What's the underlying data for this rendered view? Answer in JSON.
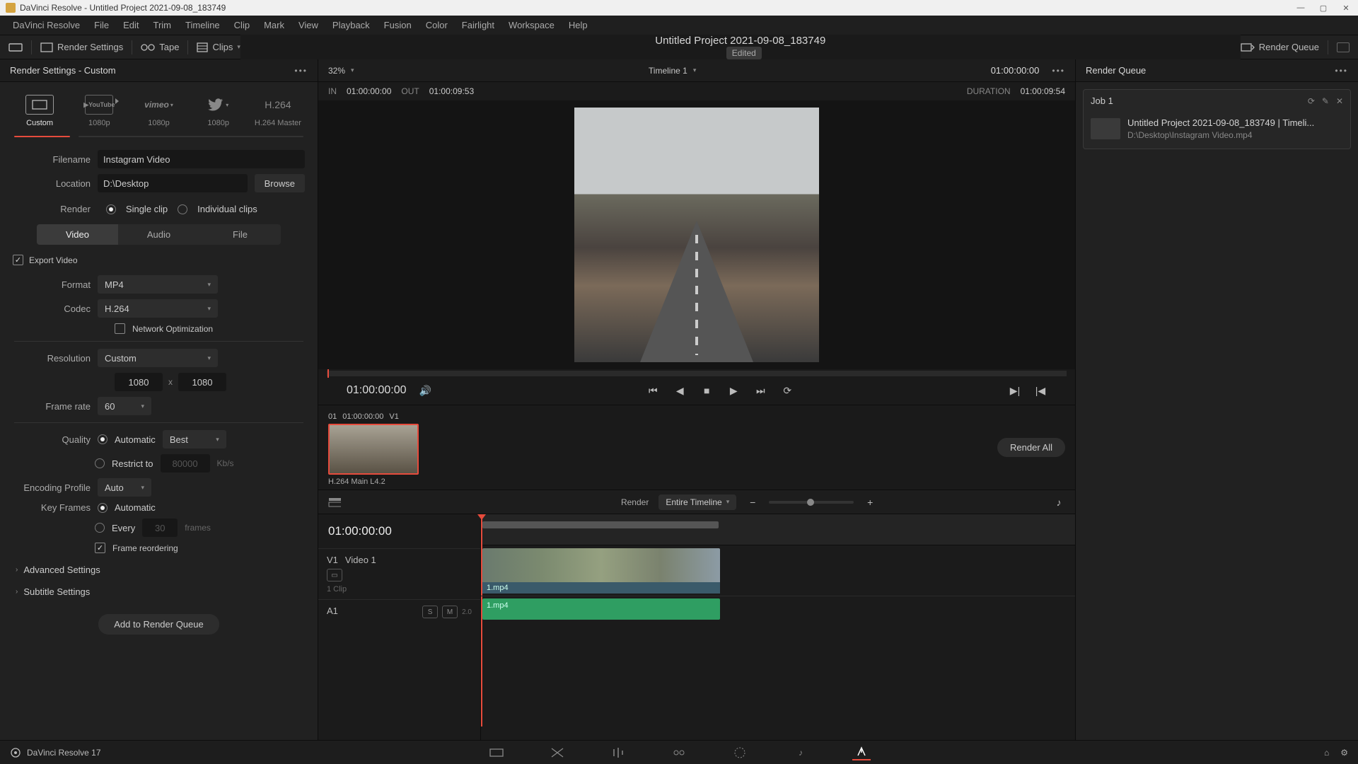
{
  "window": {
    "title": "DaVinci Resolve - Untitled Project 2021-09-08_183749"
  },
  "menu": [
    "DaVinci Resolve",
    "File",
    "Edit",
    "Trim",
    "Timeline",
    "Clip",
    "Mark",
    "View",
    "Playback",
    "Fusion",
    "Color",
    "Fairlight",
    "Workspace",
    "Help"
  ],
  "toolbar": {
    "render_settings": "Render Settings",
    "tape": "Tape",
    "clips": "Clips",
    "project_title": "Untitled Project 2021-09-08_183749",
    "edited": "Edited",
    "render_queue": "Render Queue"
  },
  "left": {
    "panel_title": "Render Settings - Custom",
    "presets": [
      {
        "label": "Custom",
        "icon": "custom",
        "active": true
      },
      {
        "label": "1080p",
        "icon": "youtube"
      },
      {
        "label": "1080p",
        "icon": "vimeo"
      },
      {
        "label": "1080p",
        "icon": "twitter"
      },
      {
        "label": "H.264 Master",
        "icon": "h264",
        "text": "H.264"
      }
    ],
    "filename_label": "Filename",
    "filename": "Instagram Video",
    "location_label": "Location",
    "location": "D:\\Desktop",
    "browse": "Browse",
    "render_label": "Render",
    "single_clip": "Single clip",
    "individual": "Individual clips",
    "tabs": [
      "Video",
      "Audio",
      "File"
    ],
    "export_video": "Export Video",
    "format_label": "Format",
    "format": "MP4",
    "codec_label": "Codec",
    "codec": "H.264",
    "net_opt": "Network Optimization",
    "res_label": "Resolution",
    "res": "Custom",
    "res_w": "1080",
    "res_h": "1080",
    "fps_label": "Frame rate",
    "fps": "60",
    "quality_label": "Quality",
    "quality_auto": "Automatic",
    "quality_best": "Best",
    "restrict": "Restrict to",
    "restrict_val": "80000",
    "kbs": "Kb/s",
    "enc_label": "Encoding Profile",
    "enc": "Auto",
    "kf_label": "Key Frames",
    "kf_auto": "Automatic",
    "kf_every": "Every",
    "kf_val": "30",
    "kf_unit": "frames",
    "frame_reorder": "Frame reordering",
    "advanced": "Advanced Settings",
    "subtitle": "Subtitle Settings",
    "add_queue": "Add to Render Queue"
  },
  "viewer": {
    "zoom": "32%",
    "timeline_name": "Timeline 1",
    "timecode": "01:00:00:00",
    "in_label": "IN",
    "in": "01:00:00:00",
    "out_label": "OUT",
    "out": "01:00:09:53",
    "dur_label": "DURATION",
    "dur": "01:00:09:54",
    "transport_tc": "01:00:00:00",
    "thumb": {
      "index": "01",
      "tc": "01:00:00:00",
      "track": "V1",
      "caption": "H.264 Main L4.2"
    },
    "render_label": "Render",
    "render_scope": "Entire Timeline"
  },
  "timeline": {
    "tc": "01:00:00:00",
    "v1": "V1",
    "v1_name": "Video 1",
    "v1_clips": "1 Clip",
    "a1": "A1",
    "clip_name": "1.mp4",
    "a1_level": "2.0"
  },
  "queue": {
    "title": "Render Queue",
    "job_name": "Job 1",
    "job_title": "Untitled Project 2021-09-08_183749 | Timeli...",
    "job_path": "D:\\Desktop\\Instagram Video.mp4",
    "render_all": "Render All"
  },
  "footer": {
    "app": "DaVinci Resolve 17"
  }
}
